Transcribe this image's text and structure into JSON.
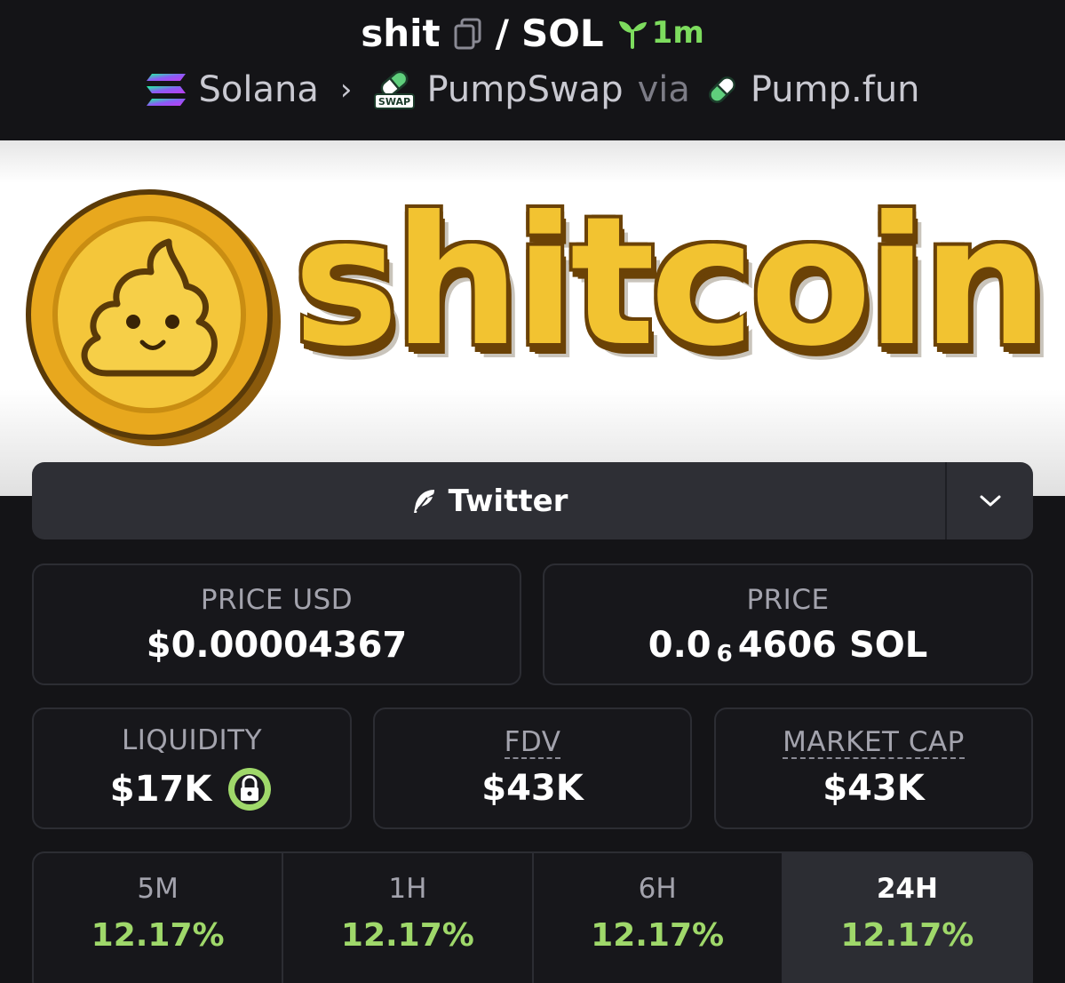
{
  "header": {
    "token": "shit",
    "separator": "/",
    "quote": "SOL",
    "age": "1m",
    "chain": "Solana",
    "dex": "PumpSwap",
    "via": "via",
    "launchpad": "Pump.fun",
    "swap_badge": "SWAP"
  },
  "banner": {
    "word": "shitcoin"
  },
  "links": {
    "twitter_label": "Twitter"
  },
  "stats": {
    "price_usd_label": "PRICE USD",
    "price_usd_value": "$0.00004367",
    "price_label": "PRICE",
    "price_prefix": "0.0",
    "price_zeros": "6",
    "price_suffix": "4606 SOL",
    "liquidity_label": "LIQUIDITY",
    "liquidity_value": "$17K",
    "fdv_label": "FDV",
    "fdv_value": "$43K",
    "mcap_label": "MARKET CAP",
    "mcap_value": "$43K"
  },
  "timeframes": [
    {
      "label": "5M",
      "value": "12.17%"
    },
    {
      "label": "1H",
      "value": "12.17%"
    },
    {
      "label": "6H",
      "value": "12.17%"
    },
    {
      "label": "24H",
      "value": "12.17%"
    }
  ],
  "colors": {
    "background": "#141417",
    "card_border": "#2c2d33",
    "positive": "#9fd86a",
    "age_green": "#7ddc5e",
    "coin_gold": "#f2c331"
  }
}
